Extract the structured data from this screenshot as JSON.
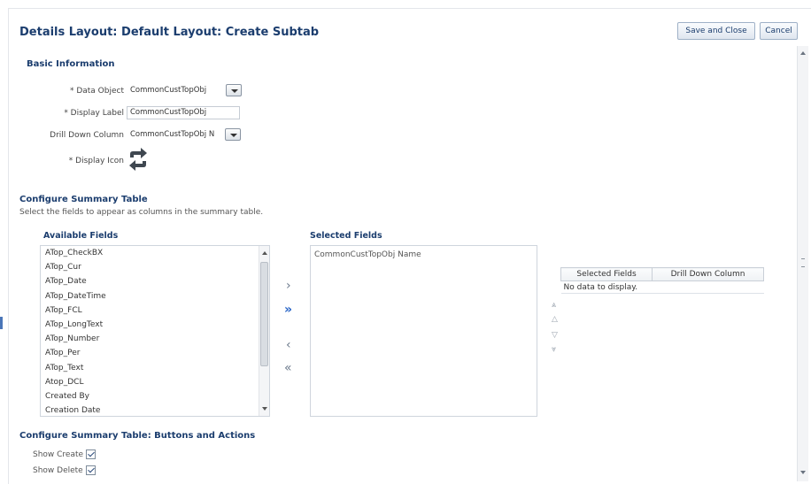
{
  "page_title": "Details Layout: Default Layout: Create Subtab",
  "toolbar": {
    "save_close_label": "Save and Close",
    "cancel_label": "Cancel"
  },
  "basic_info": {
    "heading": "Basic Information",
    "data_object_label": "* Data Object",
    "data_object_value": "CommonCustTopObj",
    "display_label_label": "* Display Label",
    "display_label_value": "CommonCustTopObj",
    "drill_down_label": "Drill Down Column",
    "drill_down_value": "CommonCustTopObj N",
    "display_icon_label": "* Display Icon"
  },
  "summary": {
    "heading": "Configure Summary Table",
    "description": "Select the fields to appear as columns in the summary table.",
    "available_heading": "Available Fields",
    "available_items": [
      "ATop_CheckBX",
      "ATop_Cur",
      "ATop_Date",
      "ATop_DateTime",
      "ATop_FCL",
      "ATop_LongText",
      "ATop_Number",
      "ATop_Per",
      "ATop_Text",
      "Atop_DCL",
      "Created By",
      "Creation Date"
    ],
    "selected_heading": "Selected Fields",
    "selected_items": [
      "CommonCustTopObj Name"
    ],
    "table_columns": [
      "Selected Fields",
      "Drill Down Column"
    ],
    "empty_text": "No data to display."
  },
  "buttons_actions": {
    "heading": "Configure Summary Table: Buttons and Actions",
    "show_create_label": "Show Create",
    "show_create_checked": true,
    "show_delete_label": "Show Delete",
    "show_delete_checked": true
  },
  "icons": {
    "display_icon": "refresh-arrows-icon",
    "move": "move-right-icon",
    "move_all": "move-all-right-icon",
    "remove": "move-left-icon",
    "remove_all": "move-all-left-icon"
  },
  "colors": {
    "heading": "#1b3d6e",
    "accent": "#2a66c7"
  }
}
